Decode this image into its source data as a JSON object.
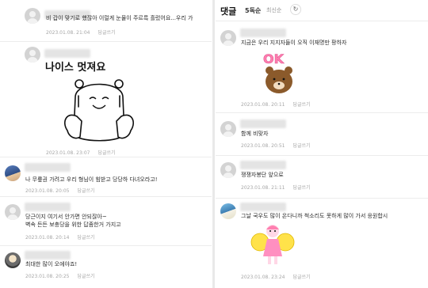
{
  "left_comments": [
    {
      "text": "비 갑이 맞기로 했잖아 이럴게 눈물이 주르륵 흘렀어요...우리 가",
      "date": "2023.01.08. 21:04",
      "reply": "답글쓰기"
    },
    {
      "sticker": "나이스 멋져요",
      "date": "2023.01.08. 23:07",
      "reply": "답글쓰기"
    },
    {
      "text": "나 무릎권 가려고 우리 형님이 힘받고 당당하 다녀오라고!",
      "date": "2023.01.08. 20:05",
      "reply": "답글쓰기"
    },
    {
      "text_lines": [
        "당근이지 여기서 안가면 안되잖아~",
        "벽속 든든 보충당을 위한 답좀한거 가지고"
      ],
      "date": "2023.01.08. 20:14",
      "reply": "답글쓰기"
    },
    {
      "text": "최대한 많이 오에야죠!",
      "date": "2023.01.08. 20:25",
      "reply": "답글쓰기"
    }
  ],
  "right_header": {
    "title": "댓글",
    "count": "5독순",
    "sort": "최신순",
    "refresh_icon": "refresh-icon"
  },
  "right_comments": [
    {
      "text": "지금은 우리 지지자들이 오직 이재명만 팡하자",
      "sticker": "OK",
      "date": "2023.01.08. 20:11",
      "reply": "답글쓰기"
    },
    {
      "text": "함께 비맞자",
      "date": "2023.01.08. 20:51",
      "reply": "답글쓰기"
    },
    {
      "text": "쟁쟁자봉단 앞으로",
      "date": "2023.01.08. 21:11",
      "reply": "답글쓰기"
    },
    {
      "text": "그날 국우도 많이 온다니까 척소리도 못하게 많이 가서 응원합시",
      "date": "2023.01.08. 23:24",
      "reply": "답글쓰기"
    }
  ]
}
